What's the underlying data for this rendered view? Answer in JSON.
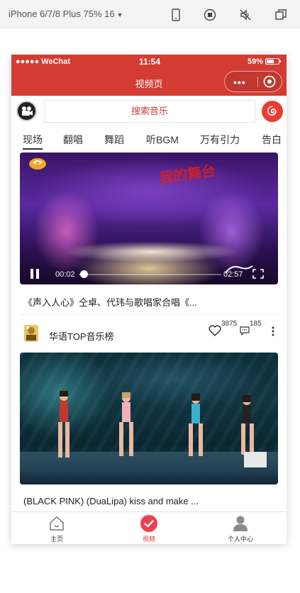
{
  "devtools": {
    "device_label": "iPhone 6/7/8 Plus 75% 16",
    "icons": [
      "phone-icon",
      "record-icon",
      "mute-icon",
      "window-icon"
    ]
  },
  "status_bar": {
    "carrier": "●●●●● WeChat",
    "time": "11:54",
    "battery": "59%"
  },
  "nav": {
    "title": "视频页",
    "capsule_more": "•••"
  },
  "search": {
    "placeholder": "搜索音乐"
  },
  "tabs": [
    "现场",
    "翻唱",
    "舞蹈",
    "听BGM",
    "万有引力",
    "告白"
  ],
  "active_tab": 0,
  "feed": {
    "video1": {
      "overlay_text": "我的舞台",
      "current_time": "00:02",
      "duration": "02:57",
      "progress": 0.01,
      "caption": "《声入人心》仝卓、代玮与歌唱家合唱《..."
    },
    "post1": {
      "author": "华语TOP音乐榜",
      "likes": "3875",
      "comments": "185"
    },
    "video2": {
      "caption": "(BLACK PINK) (DuaLipa) kiss and make ..."
    }
  },
  "tabbar": {
    "items": [
      {
        "label": "主页",
        "icon": "home-icon"
      },
      {
        "label": "视频",
        "icon": "check-circle-icon"
      },
      {
        "label": "个人中心",
        "icon": "person-icon"
      }
    ],
    "active": 1
  },
  "colors": {
    "brand": "#d43c33",
    "search_text": "#d43c33",
    "tab_active_bg": "#f24050"
  }
}
